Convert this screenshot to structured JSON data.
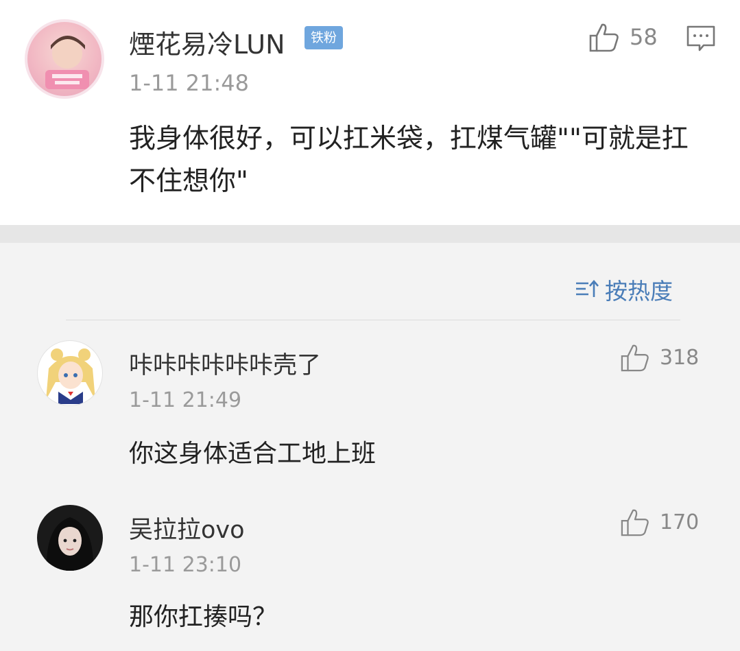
{
  "main_comment": {
    "username": "煙花易冷LUN",
    "badge": "铁粉",
    "time": "1-11 21:48",
    "text": "我身体很好，可以扛米袋，扛煤气罐\"\"可就是扛不住想你\"",
    "likes": "58",
    "icons": {
      "like": "thumbs-up-icon",
      "comment": "comment-icon"
    }
  },
  "sort": {
    "label": "按热度",
    "icon": "sort-icon"
  },
  "replies": [
    {
      "username": "咔咔咔咔咔咔壳了",
      "time": "1-11 21:49",
      "text": "你这身体适合工地上班",
      "likes": "318"
    },
    {
      "username": "吴拉拉ovo",
      "time": "1-11 23:10",
      "text": "那你扛揍吗？",
      "likes": "170"
    }
  ],
  "colors": {
    "accent": "#4a7db8",
    "badge": "#6fa6de",
    "separator": "#e6e6e6"
  }
}
